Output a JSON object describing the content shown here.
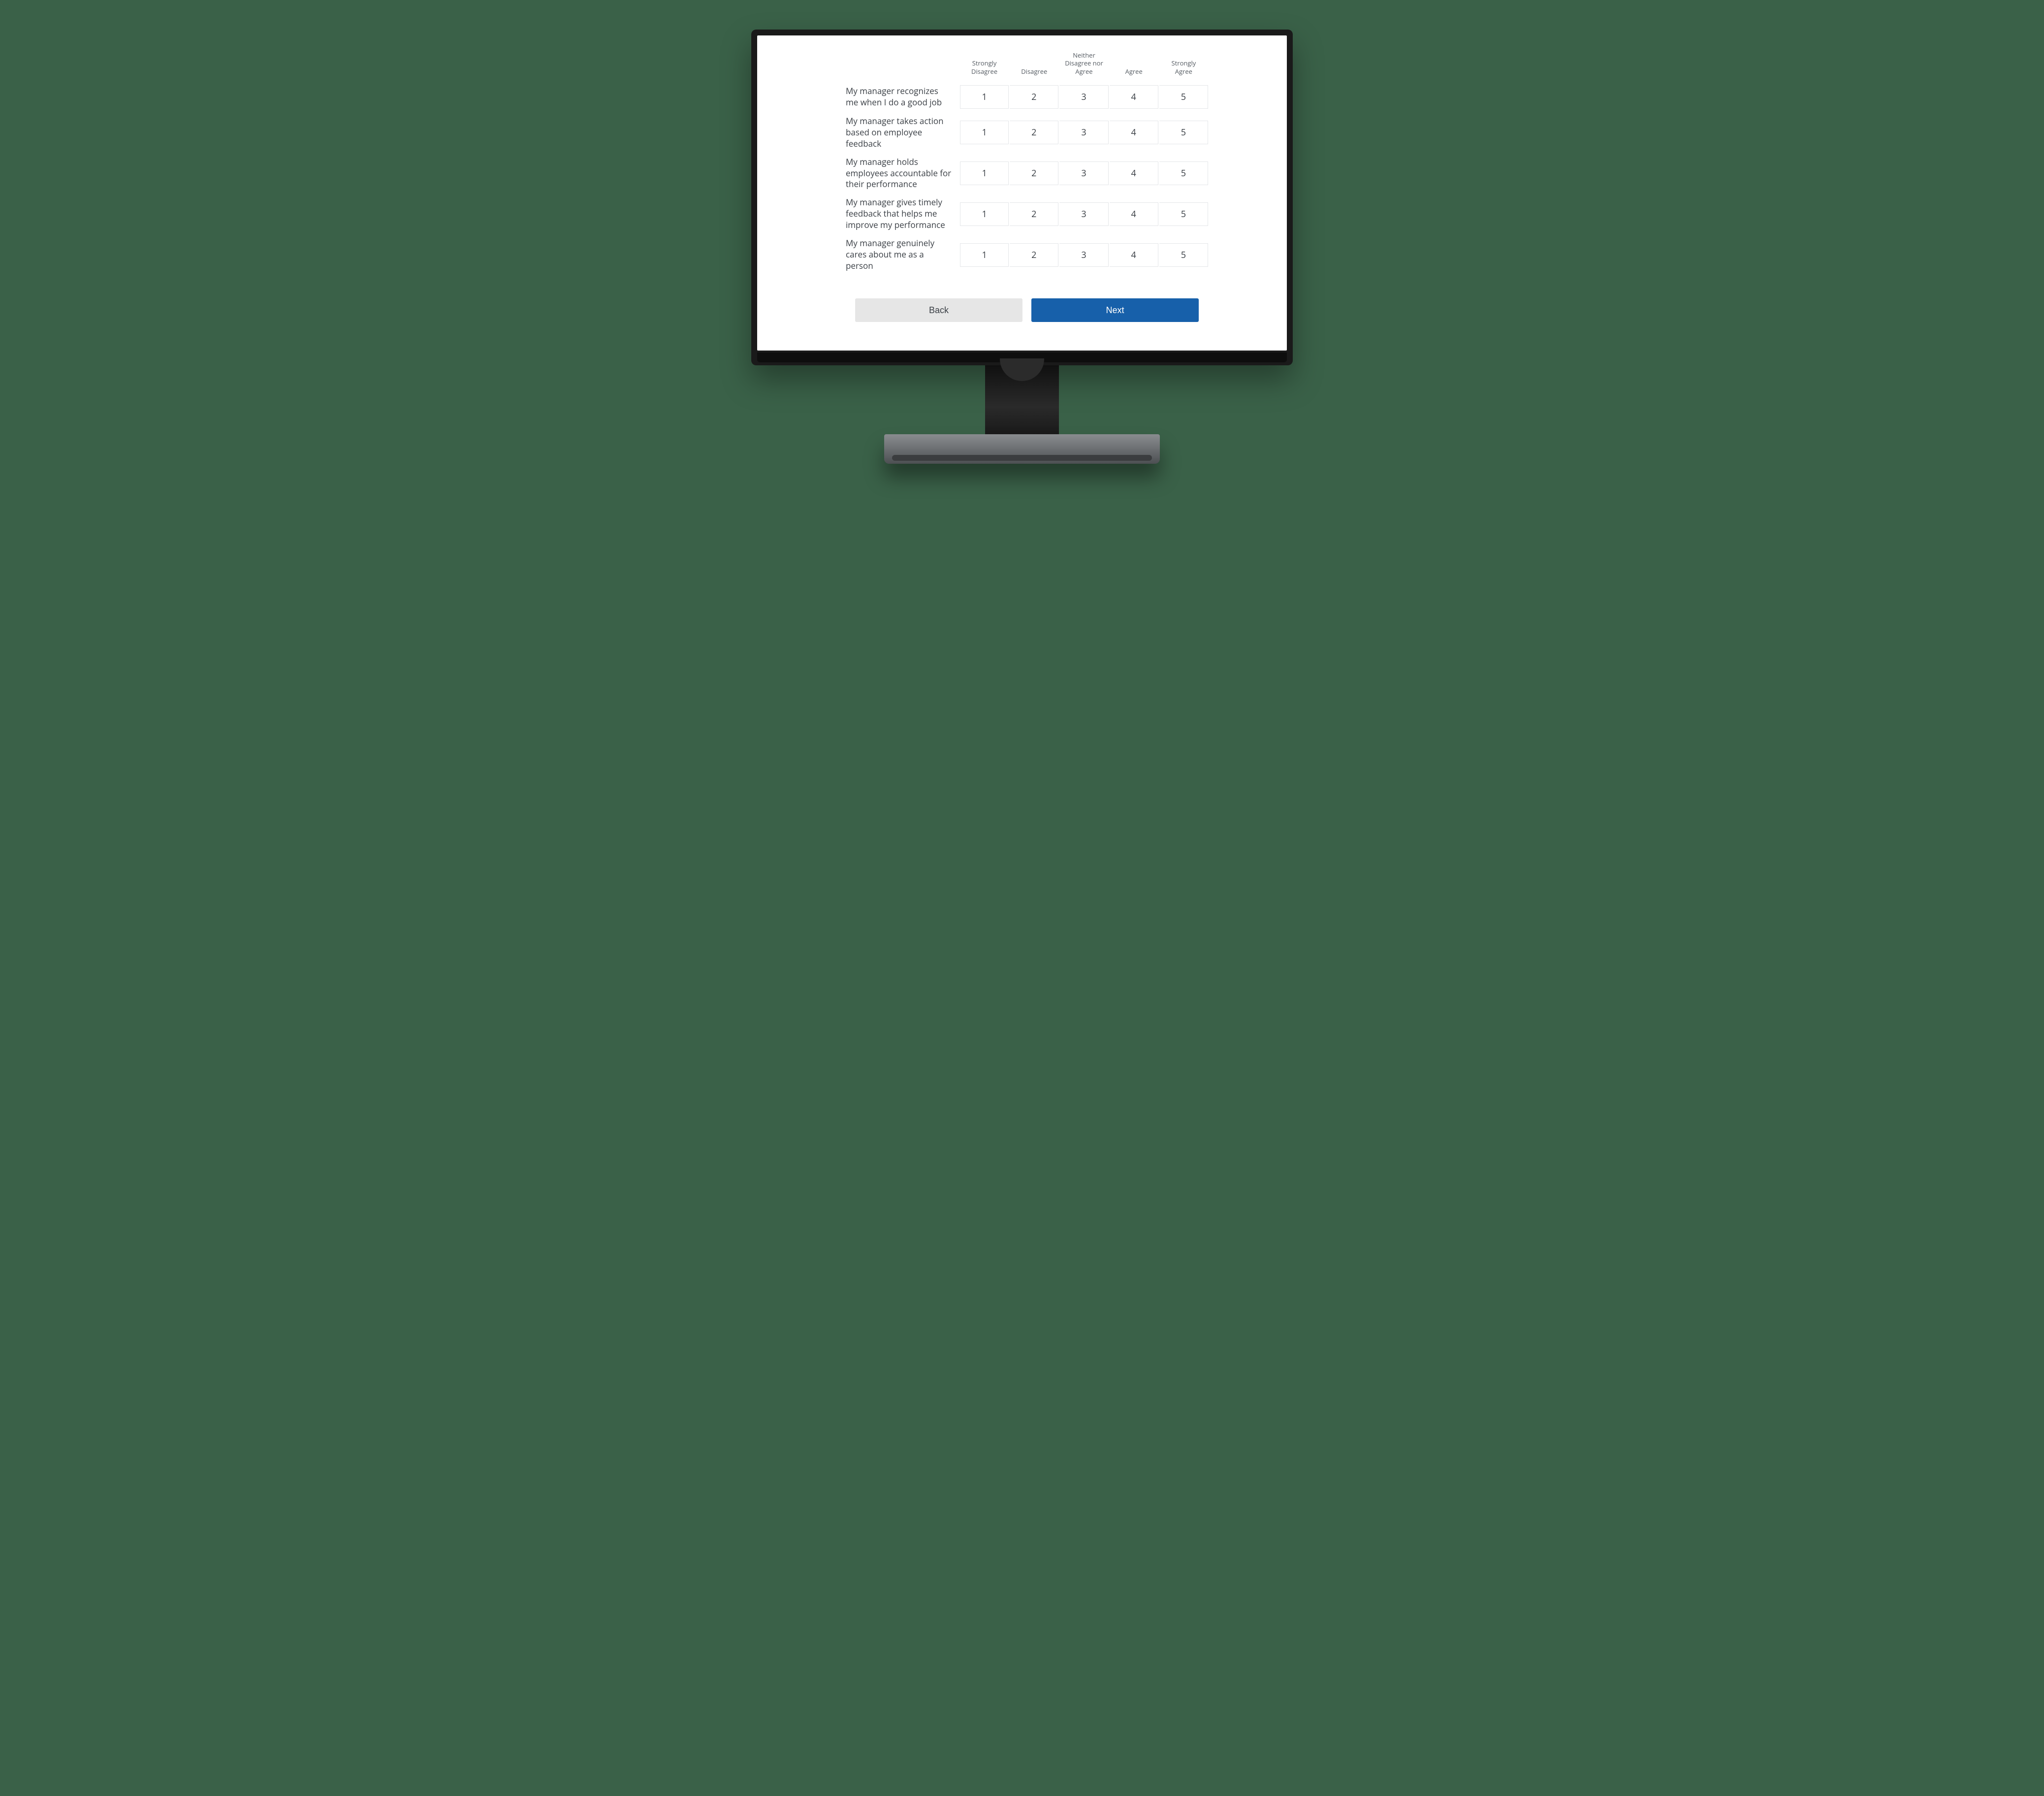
{
  "scale_headers": [
    "Strongly Disagree",
    "Disagree",
    "Neither Disagree nor Agree",
    "Agree",
    "Strongly Agree"
  ],
  "scale_values": [
    "1",
    "2",
    "3",
    "4",
    "5"
  ],
  "questions": [
    "My manager recognizes me when I do a good job",
    "My manager takes action based on employee feedback",
    "My manager holds employees accountable for their performance",
    "My manager gives timely feedback that helps me improve my performance",
    "My manager genuinely cares about me as a person"
  ],
  "nav": {
    "back_label": "Back",
    "next_label": "Next"
  }
}
